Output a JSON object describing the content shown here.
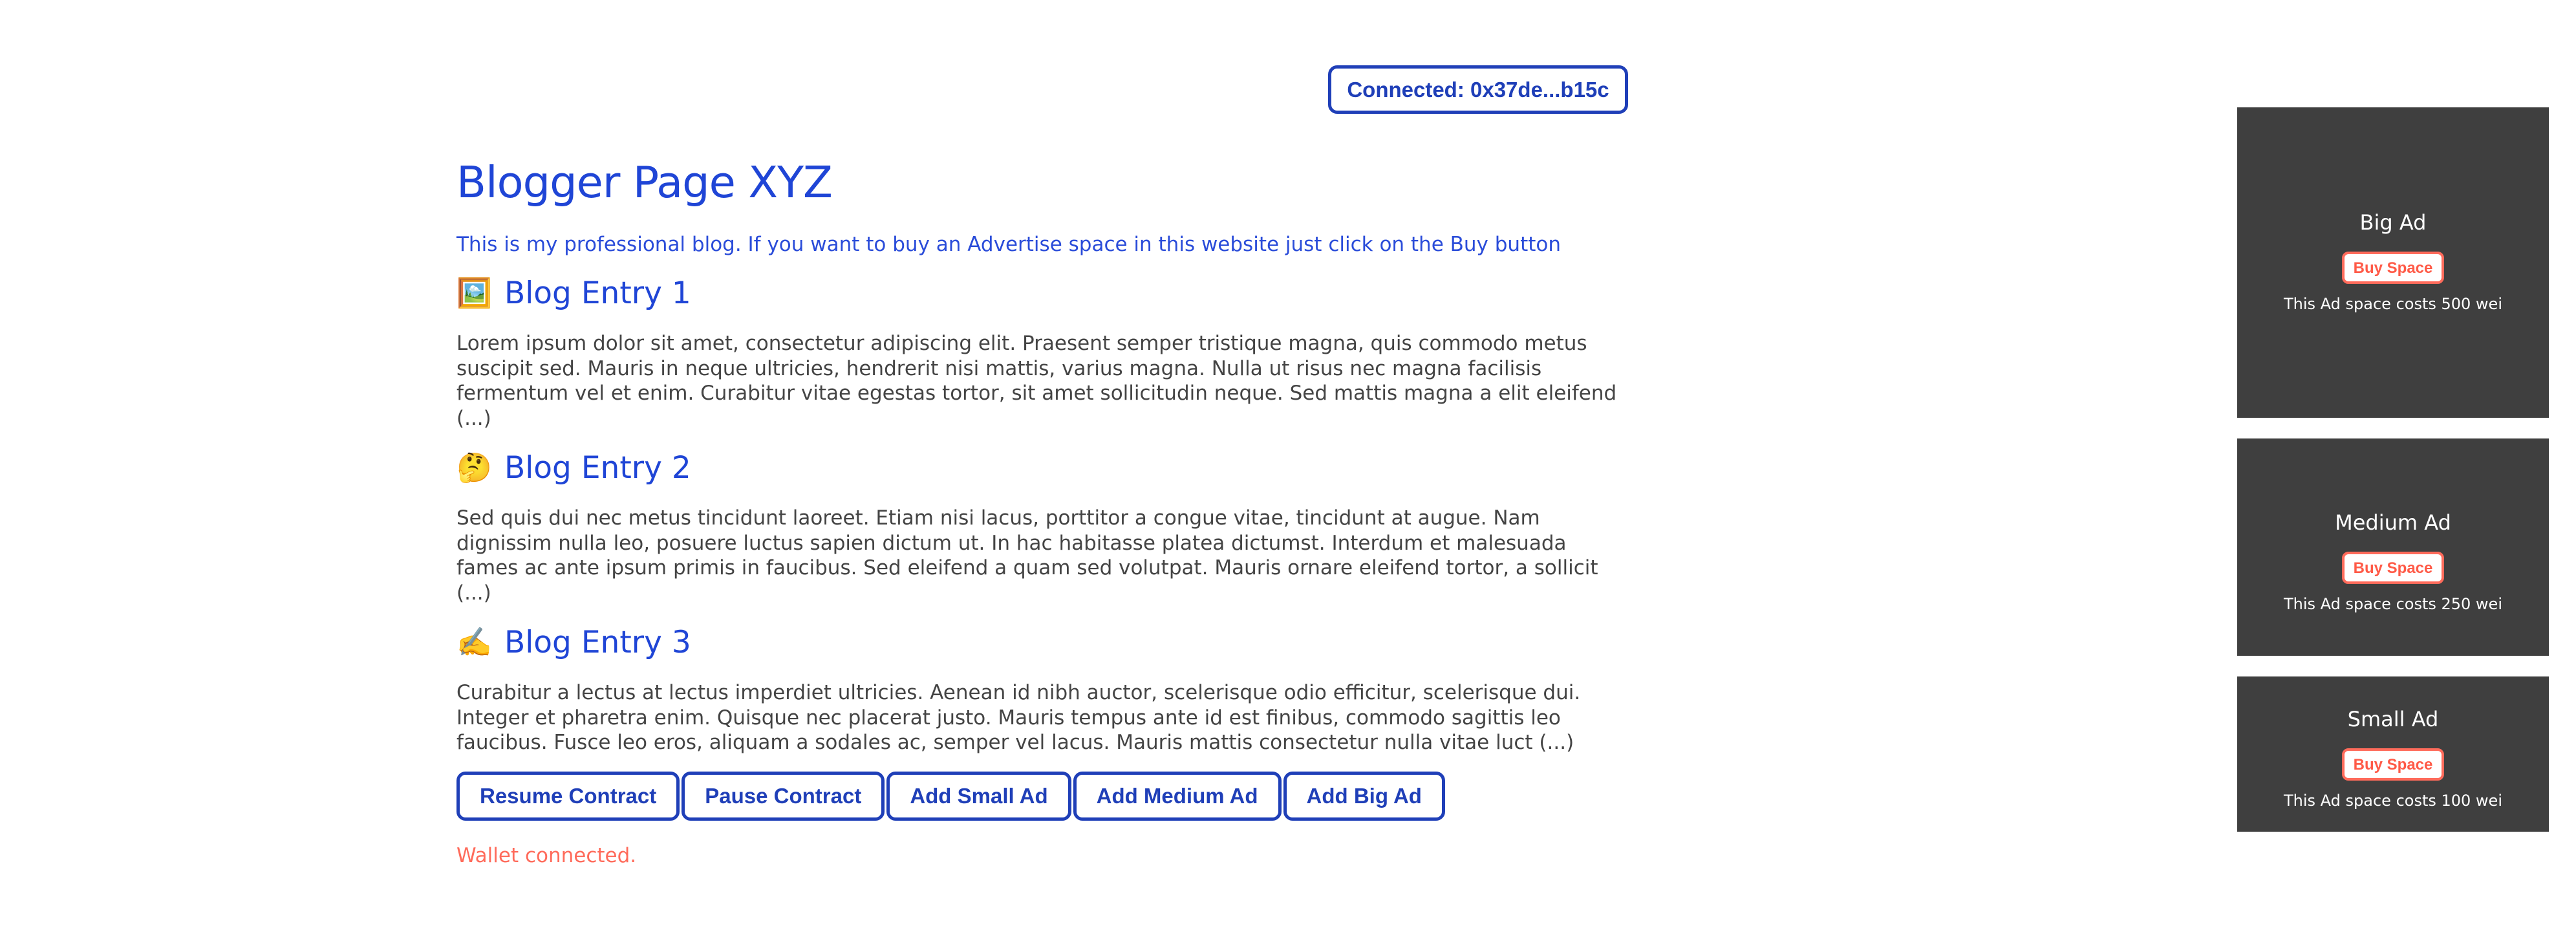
{
  "wallet": {
    "label": "Connected: 0x37de...b15c"
  },
  "blog": {
    "title": "Blogger Page XYZ",
    "intro": "This is my professional blog. If you want to buy an Advertise space in this website just click on the Buy button",
    "entries": [
      {
        "icon": "🖼️",
        "icon_name": "framed-picture-icon",
        "title": "Blog Entry 1",
        "body": "Lorem ipsum dolor sit amet, consectetur adipiscing elit. Praesent semper tristique magna, quis commodo metus suscipit sed. Mauris in neque ultricies, hendrerit nisi mattis, varius magna. Nulla ut risus nec magna facilisis fermentum vel et enim. Curabitur vitae egestas tortor, sit amet sollicitudin neque. Sed mattis magna a elit eleifend (...)"
      },
      {
        "icon": "🤔",
        "icon_name": "thinking-face-icon",
        "title": "Blog Entry 2",
        "body": "Sed quis dui nec metus tincidunt laoreet. Etiam nisi lacus, porttitor a congue vitae, tincidunt at augue. Nam dignissim nulla leo, posuere luctus sapien dictum ut. In hac habitasse platea dictumst. Interdum et malesuada fames ac ante ipsum primis in faucibus. Sed eleifend a quam sed volutpat. Mauris ornare eleifend tortor, a sollicit (...)"
      },
      {
        "icon": "✍️",
        "icon_name": "writing-hand-icon",
        "title": "Blog Entry 3",
        "body": "Curabitur a lectus at lectus imperdiet ultricies. Aenean id nibh auctor, scelerisque odio efficitur, scelerisque dui. Integer et pharetra enim. Quisque nec placerat justo. Mauris tempus ante id est finibus, commodo sagittis leo faucibus. Fusce leo eros, aliquam a sodales ac, semper vel lacus. Mauris mattis consectetur nulla vitae luct (...)"
      }
    ]
  },
  "actions": {
    "resume": "Resume Contract",
    "pause": "Pause Contract",
    "add_small": "Add Small Ad",
    "add_medium": "Add Medium Ad",
    "add_big": "Add Big Ad"
  },
  "status": {
    "text": "Wallet connected.",
    "color": "#ff6b5b"
  },
  "ads": {
    "big": {
      "title": "Big Ad",
      "button": "Buy Space",
      "price": "This Ad space costs 500 wei"
    },
    "medium": {
      "title": "Medium Ad",
      "button": "Buy Space",
      "price": "This Ad space costs 250 wei"
    },
    "small": {
      "title": "Small Ad",
      "button": "Buy Space",
      "price": "This Ad space costs 100 wei"
    }
  },
  "colors": {
    "primary": "#1f3fb8",
    "heading": "#1f45d6",
    "accent": "#ff6b5b",
    "ad_background": "#3f3f3f",
    "body_text": "#444444"
  }
}
